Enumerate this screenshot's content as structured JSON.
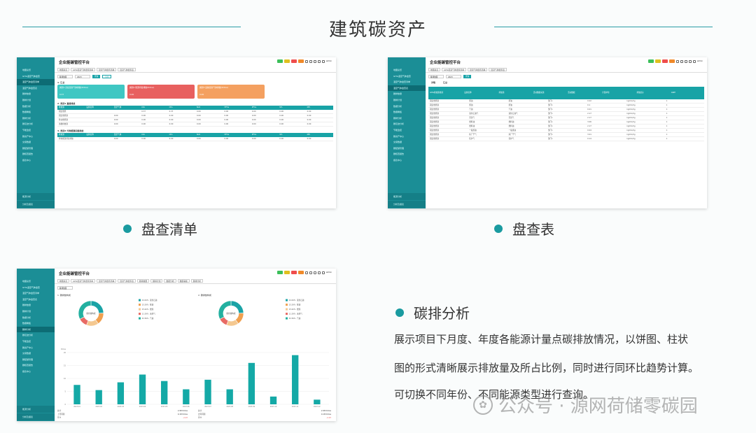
{
  "header": {
    "title": "建筑碳资产"
  },
  "captions": {
    "list": "盘查清单",
    "table": "盘查表"
  },
  "analysis": {
    "title": "碳排分析",
    "line1": "展示项目下月度、年度各能源计量点碳排放情况，以饼图、柱状",
    "line2": "图的形式清晰展示排放量及所占比例，同时进行同环比趋势计算。",
    "line3": "可切换不同年份、不同能源类型进行查询。"
  },
  "watermark": {
    "text": "公众号 · 源网荷储零碳园",
    "icon": "wechat-icon"
  },
  "app": {
    "title": "企业能碳管控平台",
    "user": "admin",
    "tag_colors": [
      "#3cbf5a",
      "#e0c020",
      "#ef4d4d",
      "#f08a2a"
    ],
    "sidebar": [
      "地图总览",
      "GHG温室气体盘查",
      "温室气体盘查清单",
      "温室气体盘查表",
      "碳排放量",
      "碳排计划",
      "数据分析",
      "数据看板",
      "碳排分析",
      "碳足迹分析",
      "节能监控",
      "碳资产中心",
      "交易数据",
      "碳配额管理",
      "碳核查报告",
      "报表中心"
    ],
    "sidebar_bottom": [
      "能源分析",
      "分析及报表"
    ],
    "tabs": [
      "地图总览",
      "GHG温室气体盘查清单",
      "温室气体盘查清单",
      "温室气体盘查表"
    ],
    "select": "碳排放量",
    "year": "2023",
    "btn_query": "查询",
    "btn_export": "导出"
  },
  "screen1": {
    "sec_summary": "1. 汇总",
    "cards": [
      {
        "label": "类别1 直接温室气体排放(tCO₂e)",
        "value": "0.37",
        "color": "#3fc7c3"
      },
      {
        "label": "类别2 能源间接排放(tCO₂e)",
        "value": "0.00",
        "color": "#e8605f"
      },
      {
        "label": "类别3 运输温室气体排放(tCO₂e)",
        "value": "0.00",
        "color": "#f4a060"
      }
    ],
    "sec_a": "2. 类别1 直接排放",
    "headers": [
      "排放源",
      "设施名称",
      "温室气体",
      "CO₂",
      "CH₄",
      "N₂O",
      "HFCs",
      "PFCs",
      "SF₆",
      "NF₃"
    ],
    "rows_a": [
      [
        "固定燃烧",
        "",
        "",
        "0.37",
        "0.37",
        "0.00",
        "0.00",
        "0.00",
        "0.00",
        "0.00"
      ],
      [
        "固定燃烧源",
        "",
        "0.00",
        "0.00",
        "0.00",
        "0.00",
        "0.00",
        "0.00",
        "0.00",
        "0.00"
      ],
      [
        "移动燃烧源",
        "",
        "0.00",
        "0.00",
        "0.00",
        "0.00",
        "0.00",
        "0.00",
        "0.00",
        "0.00"
      ],
      [
        "逸散排放源",
        "",
        "0.00",
        "0.00",
        "0.00",
        "0.00",
        "0.00",
        "0.00",
        "0.00",
        "0.00"
      ]
    ],
    "sec_b": "3. 类别2 外购能源间接排放",
    "rows_b": [
      [
        "外购能源间接排放",
        "",
        "0.00",
        "0.00",
        "0.00",
        "0.00",
        "0.00",
        "0.00",
        "0.00",
        "0.00"
      ]
    ]
  },
  "screen2": {
    "sub_tabs": [
      "详情",
      "汇总"
    ],
    "headers": [
      "GHG排放源类别",
      "设施名称",
      "排放源",
      "活动数据来源",
      "活动数据",
      "计量单位",
      "排放因子",
      "GWP"
    ],
    "rows": [
      [
        "固定燃烧源",
        "柴油",
        "柴油",
        "部门1",
        "0.02",
        "kgCO₂/kg",
        "1"
      ],
      [
        "固定燃烧源",
        "柴油",
        "柴油",
        "部门1",
        "0.1",
        "kgCO₂/kg",
        "1"
      ],
      [
        "固定燃烧源",
        "汽油",
        "汽油",
        "部门1",
        "0.01",
        "kgCO₂/kg",
        "1"
      ],
      [
        "固定燃烧源",
        "液化石油气",
        "液化石油气",
        "部门1",
        "2.17",
        "kgCO₂/kg",
        "1"
      ],
      [
        "固定燃烧源",
        "天然气",
        "天然气",
        "部门1",
        "2.17",
        "kgCO₂/kg",
        "1"
      ],
      [
        "固定燃烧源",
        "燃料油",
        "燃料油",
        "部门1",
        "3.06",
        "kgCO₂/kg",
        "1"
      ],
      [
        "固定燃烧源",
        "燃料油",
        "燃料油",
        "部门1",
        "2.17",
        "kgCO₂/kg",
        "1"
      ],
      [
        "固定燃烧源",
        "一般煤油",
        "一般煤油",
        "部门1",
        "0.04",
        "kgCO₂/kg",
        "1"
      ],
      [
        "固定燃烧源",
        "炼厂干气",
        "炼厂干气",
        "部门1",
        "3.01",
        "kgCO₂/kg",
        "1"
      ],
      [
        "固定燃烧源",
        "焦炉气",
        "焦炉气",
        "部门1",
        "0.14",
        "kgCO₂/kg",
        "1"
      ]
    ]
  },
  "screen3": {
    "tabs": [
      "地图总览",
      "GHG温室气体盘查清单",
      "温室气体盘查清单",
      "温室气体盘查表",
      "碳排放量",
      "碳排计划",
      "数据分析",
      "数据看板",
      "碳排分析"
    ],
    "pie_left_title": "1. 碳排放构成",
    "pie_right_title": "2. 碳排放构成",
    "pie_center": "碳排放构成",
    "pie": [
      {
        "name": "液化石油",
        "pct": 24.64,
        "color": "#1aa3a6"
      },
      {
        "name": "柴油",
        "pct": 15.59,
        "color": "#f0a050"
      },
      {
        "name": "燃煤",
        "pct": 15.62,
        "color": "#f4c890"
      },
      {
        "name": "天然气",
        "pct": 11.59,
        "color": "#e86a64"
      },
      {
        "name": "汽油",
        "pct": 32.56,
        "color": "#23b0a0"
      }
    ],
    "legend_left": [
      [
        "24.64%",
        "液化石油"
      ],
      [
        "15.59%",
        "柴油"
      ],
      [
        "15.62%",
        "燃煤"
      ],
      [
        "11.59%",
        "天然气"
      ],
      [
        "32.56%",
        "汽油"
      ]
    ],
    "bar_unit": "tCO₂e",
    "chart_data": {
      "type": "bar",
      "categories": [
        "2023-01",
        "2023-02",
        "2023-03",
        "2023-04",
        "2023-05",
        "2023-06",
        "2023-07",
        "2023-08",
        "2023-09",
        "2023-10",
        "2023-11",
        "2023-12"
      ],
      "values": [
        7.5,
        5.5,
        8.5,
        11.5,
        9,
        5.8,
        9.5,
        5.8,
        16,
        3,
        19,
        1.8
      ],
      "ylim": [
        0,
        20
      ]
    },
    "stats_left": [
      [
        "总计",
        "2.98 tCO₂e"
      ],
      [
        "上月同期",
        "0.18 tCO₂e"
      ],
      [
        "环比",
        "-2.07"
      ]
    ],
    "stats_right": [
      [
        "总计",
        "2.98 tCO₂e"
      ],
      [
        "去年同期",
        "0.18 tCO₂e"
      ],
      [
        "同比",
        "-2.07"
      ]
    ]
  }
}
